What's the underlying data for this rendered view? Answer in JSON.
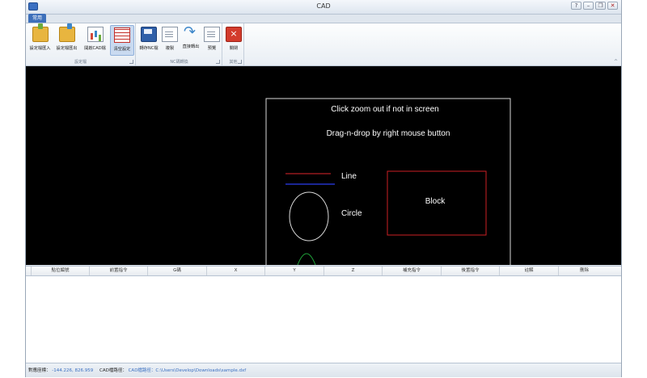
{
  "window": {
    "title": "CAD",
    "controls": [
      "?",
      "–",
      "❐",
      "✕"
    ]
  },
  "ribbon": {
    "tab": "常用",
    "groups": [
      {
        "label": "設定檔",
        "buttons": [
          {
            "label": "設定檔匯入",
            "icon": "folder-import-icon"
          },
          {
            "label": "設定檔匯出",
            "icon": "folder-export-icon"
          },
          {
            "label": "開啟CAD檔",
            "icon": "open-cad-icon"
          },
          {
            "label": "清空設定",
            "icon": "clear-settings-icon"
          }
        ]
      },
      {
        "label": "NC碼轉換",
        "buttons": [
          {
            "label": "轉存NC檔",
            "icon": "save-nc-icon"
          },
          {
            "label": "複製",
            "icon": "copy-icon"
          },
          {
            "label": "直接轉出",
            "icon": "direct-export-icon"
          },
          {
            "label": "預覽",
            "icon": "preview-icon"
          }
        ]
      },
      {
        "label": "其他",
        "buttons": [
          {
            "label": "關閉",
            "icon": "close-icon"
          }
        ]
      }
    ],
    "collapse_icon": "^"
  },
  "canvas": {
    "hint_zoom": "Click zoom out if not in screen",
    "hint_drag": "Drag-n-drop by right mouse button",
    "legend_line": "Line",
    "legend_circle": "Circle",
    "block_label": "Block",
    "colors": {
      "background": "#000000",
      "frame": "#d9d9d9",
      "line_red": "#e0262b",
      "line_blue": "#2332c8",
      "circle": "#d9d9d9",
      "block": "#cc1f24",
      "arc": "#1fa33a"
    }
  },
  "grid": {
    "columns": [
      "點位編號",
      "前置指令",
      "G碼",
      "X",
      "Y",
      "Z",
      "補充指令",
      "後置指令",
      "註解",
      "刪除"
    ]
  },
  "status": {
    "coord_label": "對應座標：",
    "coord_value": "-144.226, 826.959",
    "path_label": "CAD檔路徑：",
    "path_value": "CAD檔路徑：C:\\Users\\Develop\\Downloads\\sample.dxf"
  }
}
